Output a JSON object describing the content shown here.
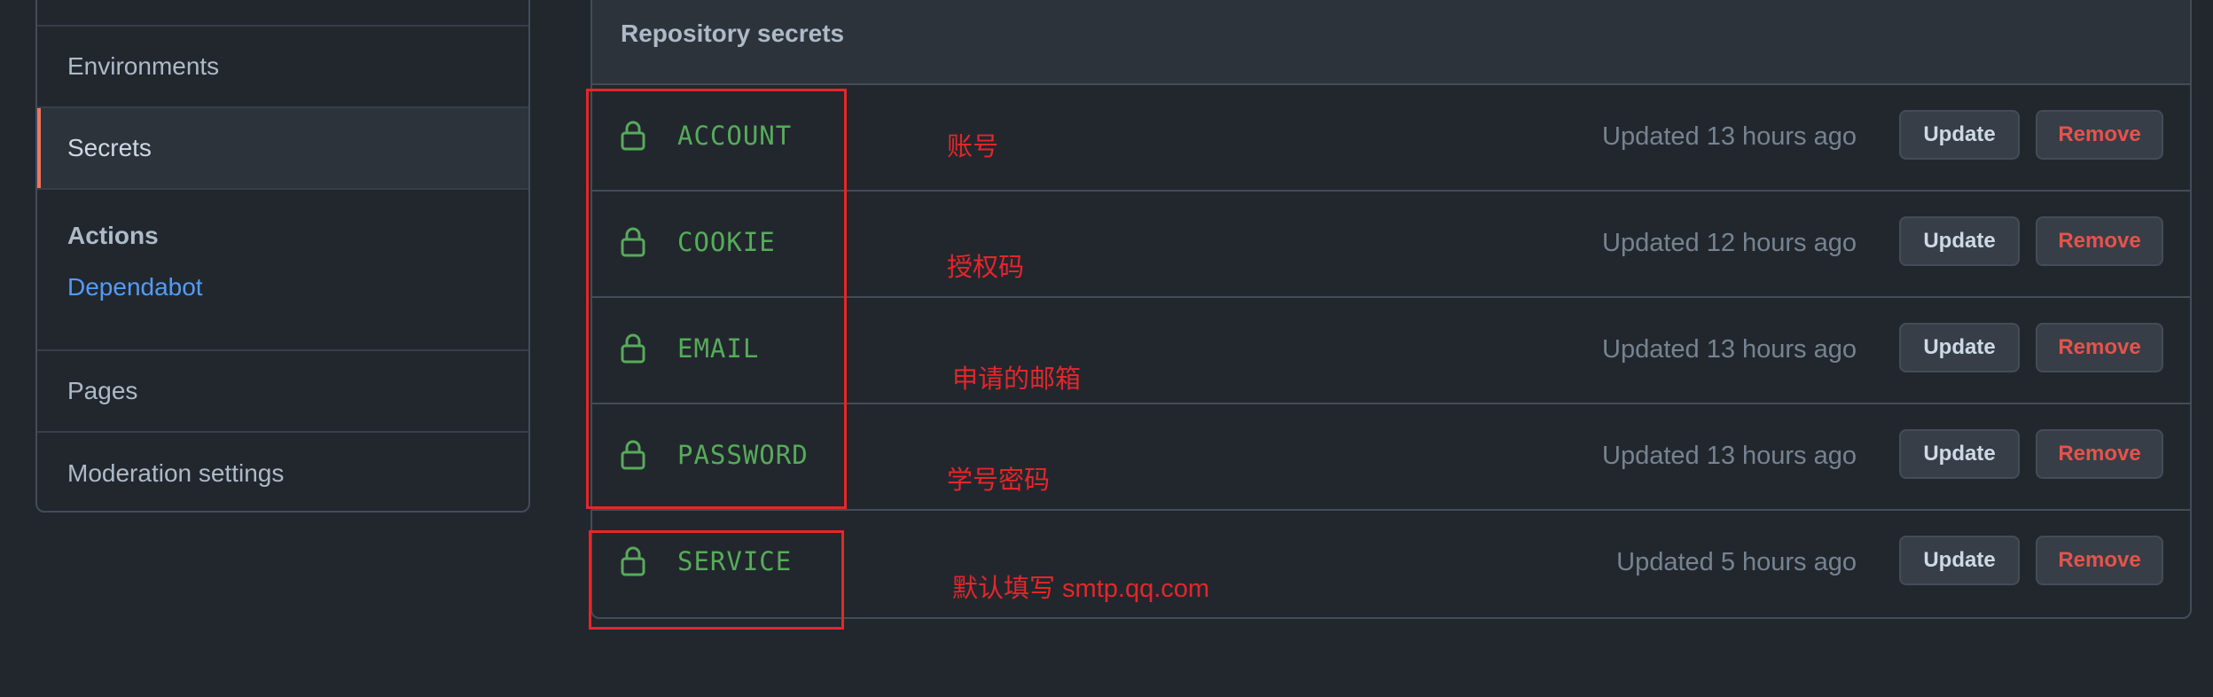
{
  "sidebar": {
    "items": [
      {
        "label": "Environments"
      },
      {
        "label": "Secrets"
      },
      {
        "label": "Pages"
      },
      {
        "label": "Moderation settings"
      }
    ],
    "actions_group": {
      "title": "Actions",
      "link": "Dependabot"
    }
  },
  "panel": {
    "title": "Repository secrets",
    "secrets": [
      {
        "name": "ACCOUNT",
        "updated": "Updated 13 hours ago",
        "annotation": "账号",
        "update_label": "Update",
        "remove_label": "Remove"
      },
      {
        "name": "COOKIE",
        "updated": "Updated 12 hours ago",
        "annotation": "授权码",
        "update_label": "Update",
        "remove_label": "Remove"
      },
      {
        "name": "EMAIL",
        "updated": "Updated 13 hours ago",
        "annotation": "申请的邮箱",
        "update_label": "Update",
        "remove_label": "Remove"
      },
      {
        "name": "PASSWORD",
        "updated": "Updated 13 hours ago",
        "annotation": "学号密码",
        "update_label": "Update",
        "remove_label": "Remove"
      },
      {
        "name": "SERVICE",
        "updated": "Updated 5 hours ago",
        "annotation": "默认填写 smtp.qq.com",
        "update_label": "Update",
        "remove_label": "Remove"
      }
    ]
  },
  "colors": {
    "background": "#22272e",
    "secret_name": "#57ab5a",
    "annotation_red": "#e5262a",
    "link_blue": "#539bf5",
    "remove_red": "#e5534b",
    "active_accent": "#ec775c"
  },
  "icons": {
    "secret_row": "lock-icon"
  }
}
